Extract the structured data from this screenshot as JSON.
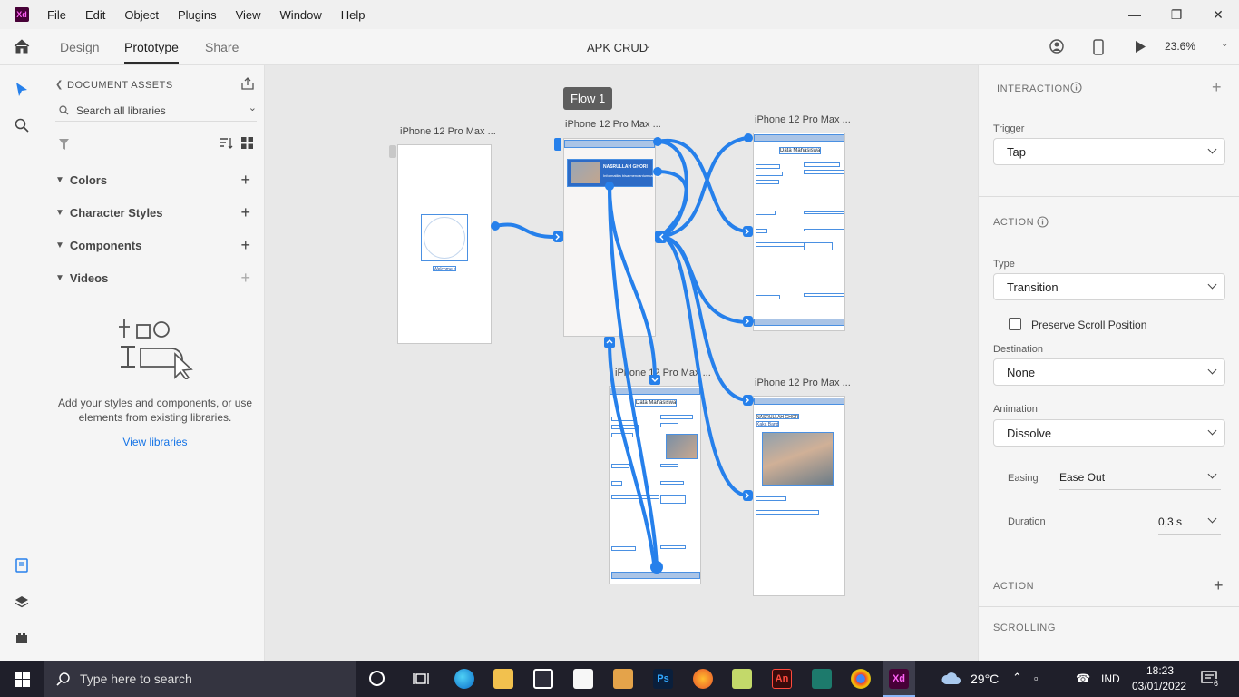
{
  "window": {
    "logo": "Xd",
    "menu": [
      "File",
      "Edit",
      "Object",
      "Plugins",
      "View",
      "Window",
      "Help"
    ]
  },
  "toolbar": {
    "tabs": [
      "Design",
      "Prototype",
      "Share"
    ],
    "active_tab": "Prototype",
    "doc_title": "APK CRUD",
    "zoom": "23.6%"
  },
  "assets": {
    "header": "DOCUMENT ASSETS",
    "search_placeholder": "Search all libraries",
    "sections": [
      "Colors",
      "Character Styles",
      "Components",
      "Videos"
    ],
    "empty_text": "Add your styles and components, or use elements from existing libraries.",
    "view_libraries": "View libraries"
  },
  "canvas": {
    "flow_label": "Flow 1",
    "artboards": [
      {
        "title": "iPhone 12 Pro Max ...",
        "caption": "Welcome aplik"
      },
      {
        "title": "iPhone 12 Pro Max ...",
        "name": "NASRULLAH GHORI",
        "sub": "Informatika bisa mencantumkan ab/b"
      },
      {
        "title": "iPhone 12 Pro Max ...",
        "heading": "Data Mahasiswa"
      },
      {
        "title": "iPhone 12 Pro Max ...",
        "heading": "Data Mahasiswa"
      },
      {
        "title": "iPhone 12 Pro Max ...",
        "name": "NASRULLAH GHORI",
        "sub": "Kaka Bandi"
      }
    ]
  },
  "props": {
    "interaction": "INTERACTION",
    "trigger_label": "Trigger",
    "trigger": "Tap",
    "action": "ACTION",
    "type_label": "Type",
    "type": "Transition",
    "preserve_scroll": "Preserve Scroll Position",
    "destination_label": "Destination",
    "destination": "None",
    "animation_label": "Animation",
    "animation": "Dissolve",
    "easing_label": "Easing",
    "easing": "Ease Out",
    "duration_label": "Duration",
    "duration": "0,3 s",
    "action2": "ACTION",
    "scrolling": "SCROLLING"
  },
  "taskbar": {
    "search_placeholder": "Type here to search",
    "temperature": "29°C",
    "language": "IND",
    "time": "18:23",
    "date": "03/01/2022",
    "notifications": "6"
  },
  "colors": {
    "accent": "#2680eb",
    "wire": "#2680eb"
  }
}
